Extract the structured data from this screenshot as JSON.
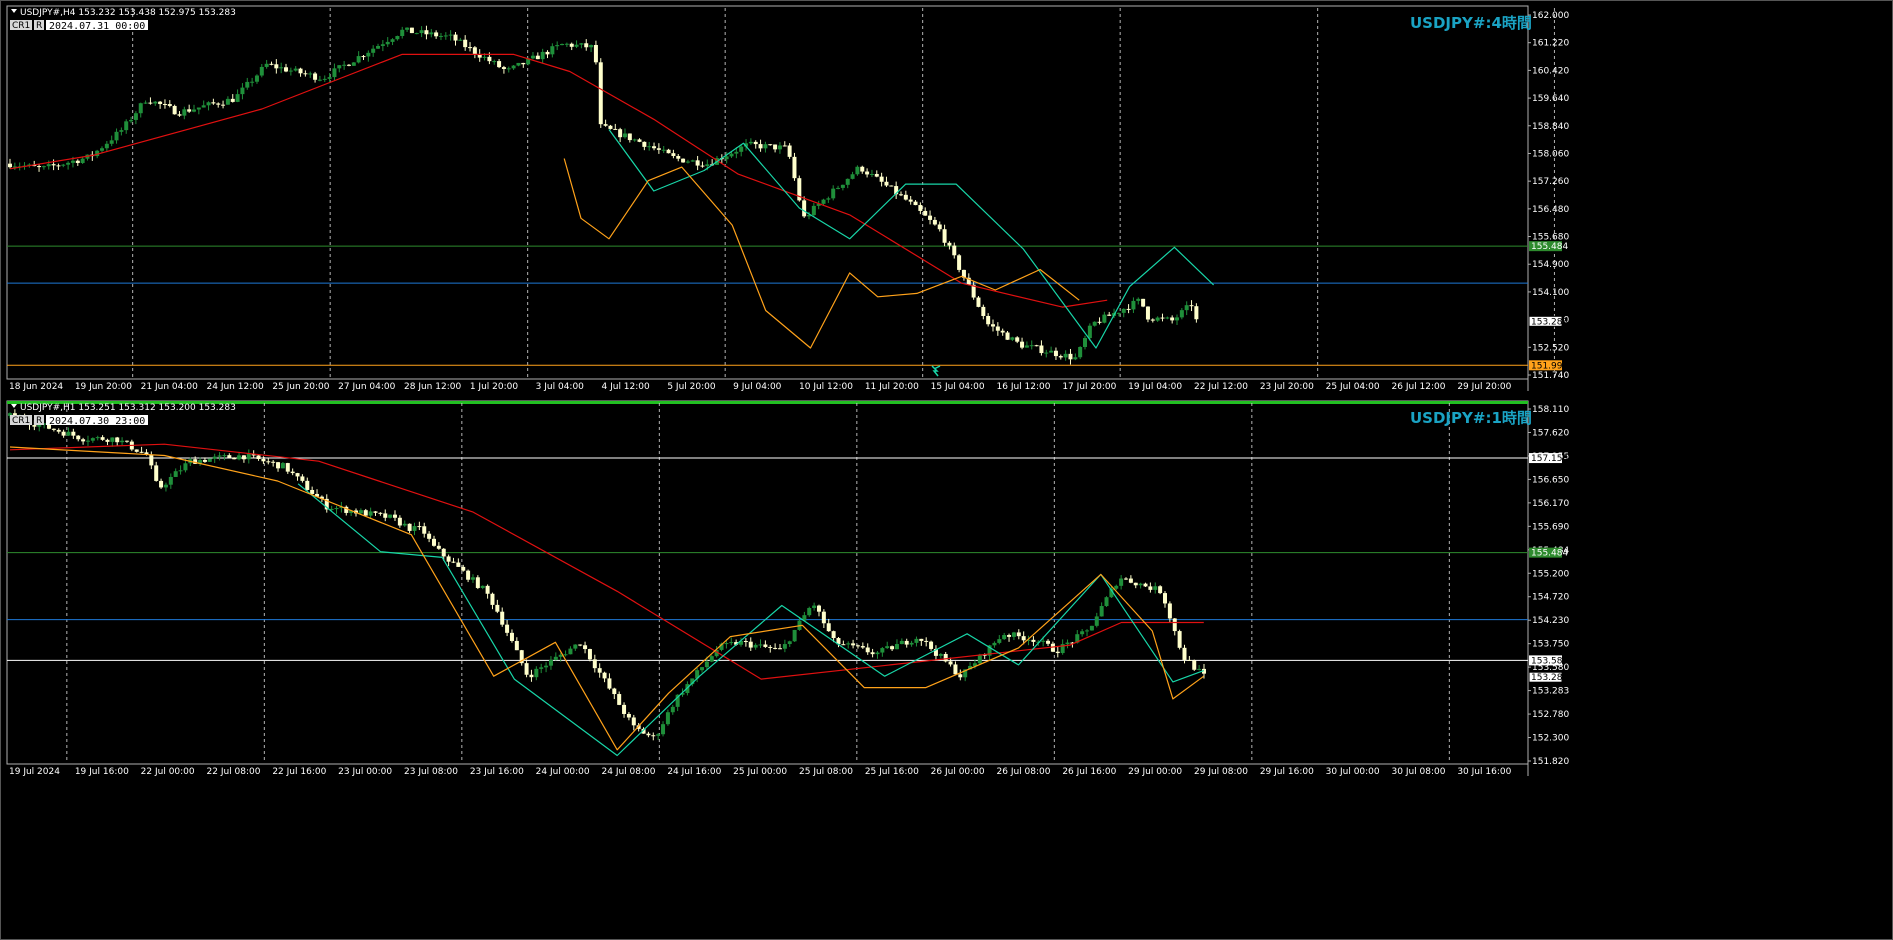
{
  "colors": {
    "background": "#000000",
    "foreground": "#ffffff",
    "grid": "#c8c8c8",
    "bull_candle": "#1f8f3a",
    "bear_candle": "#ffffcc",
    "ma_line": "#e01010",
    "fast_line": "#ffa21a",
    "slow_line": "#18d6a8",
    "hline_green": "#2e8b2e",
    "hline_blue": "#1e78d6",
    "hline_orange": "#ffa21a",
    "hline_white": "#ffffff",
    "watermark": "#1aa3c4"
  },
  "chart_data": [
    {
      "type": "candlestick",
      "panel": "top",
      "header": "USDJPY#,H4  153.232 153.438 152.975 153.283",
      "watermark": "USDJPY#:4時間",
      "crosshair": {
        "cr_label": "CR1",
        "r_label": "R",
        "datetime": "2024.07.31 00:00"
      },
      "ylim": [
        151.74,
        162.4
      ],
      "y_ticks": [
        "162.000",
        "161.220",
        "160.420",
        "159.640",
        "158.840",
        "158.060",
        "157.260",
        "156.480",
        "155.680",
        "154.900",
        "154.100",
        "153.520",
        "152.520",
        "151.740"
      ],
      "x_ticks": [
        "18 Jun 2024",
        "19 Jun 20:00",
        "21 Jun 04:00",
        "24 Jun 12:00",
        "25 Jun 20:00",
        "27 Jun 04:00",
        "28 Jun 12:00",
        "1 Jul 20:00",
        "3 Jul 04:00",
        "4 Jul 12:00",
        "5 Jul 20:00",
        "9 Jul 04:00",
        "10 Jul 12:00",
        "11 Jul 20:00",
        "15 Jul 04:00",
        "16 Jul 12:00",
        "17 Jul 20:00",
        "19 Jul 04:00",
        "22 Jul 12:00",
        "23 Jul 20:00",
        "25 Jul 04:00",
        "26 Jul 12:00",
        "29 Jul 20:00"
      ],
      "grid_after_tick": [
        2,
        5,
        8,
        11,
        14,
        17,
        20
      ],
      "grid_extra": [
        1.475
      ],
      "n_candles": 246,
      "anchors": [
        [
          0,
          157.9
        ],
        [
          8,
          157.75
        ],
        [
          20,
          158.1
        ],
        [
          28,
          158.9
        ],
        [
          34,
          159.8
        ],
        [
          42,
          159.4
        ],
        [
          56,
          159.8
        ],
        [
          64,
          160.8
        ],
        [
          78,
          160.4
        ],
        [
          98,
          161.8
        ],
        [
          110,
          161.6
        ],
        [
          124,
          160.6
        ],
        [
          138,
          161.4
        ],
        [
          146,
          161.3
        ],
        [
          147,
          159
        ],
        [
          158,
          158.5
        ],
        [
          166,
          158.05
        ],
        [
          174,
          157.9
        ],
        [
          184,
          158.45
        ],
        [
          194,
          158.35
        ],
        [
          198,
          156.3
        ],
        [
          212,
          157.8
        ],
        [
          224,
          156.8
        ],
        [
          232,
          155.95
        ],
        [
          244,
          153.2
        ],
        [
          252,
          152.6
        ],
        [
          266,
          152.2
        ],
        [
          270,
          153.2
        ],
        [
          282,
          153.9
        ],
        [
          284,
          153.4
        ],
        [
          290,
          153.3
        ],
        [
          295,
          153.8
        ],
        [
          296,
          153.3
        ]
      ],
      "ma": [
        [
          0,
          157.75
        ],
        [
          30,
          158.15
        ],
        [
          90,
          159.5
        ],
        [
          140,
          161.1
        ],
        [
          180,
          161.1
        ],
        [
          200,
          160.6
        ],
        [
          230,
          159.2
        ],
        [
          260,
          157.6
        ],
        [
          300,
          156.4
        ],
        [
          340,
          154.4
        ],
        [
          376,
          153.7
        ],
        [
          392,
          153.9
        ]
      ],
      "fast": [
        [
          198,
          158.05
        ],
        [
          204,
          156.3
        ],
        [
          214,
          155.7
        ],
        [
          228,
          157.4
        ],
        [
          240,
          157.8
        ],
        [
          258,
          156.1
        ],
        [
          270,
          153.6
        ],
        [
          286,
          152.5
        ],
        [
          300,
          154.7
        ],
        [
          310,
          154
        ],
        [
          324,
          154.1
        ],
        [
          340,
          154.6
        ],
        [
          352,
          154.2
        ],
        [
          368,
          154.8
        ],
        [
          382,
          153.9
        ]
      ],
      "slow": [
        [
          214,
          158.9
        ],
        [
          230,
          157.1
        ],
        [
          248,
          157.7
        ],
        [
          262,
          158.5
        ],
        [
          282,
          156.6
        ],
        [
          300,
          155.7
        ],
        [
          320,
          157.3
        ],
        [
          338,
          157.3
        ],
        [
          362,
          155.4
        ],
        [
          388,
          152.5
        ],
        [
          400,
          154.3
        ],
        [
          416,
          155.45
        ],
        [
          430,
          154.35
        ]
      ],
      "hlines": [
        {
          "price": 155.484,
          "color": "hline_green",
          "label": "155.484"
        },
        {
          "price": 154.4,
          "color": "hline_blue",
          "label": ""
        },
        {
          "price": 151.995,
          "color": "hline_orange",
          "label": "151.995"
        }
      ],
      "price_tag": "153.283",
      "marker_at": 0.62
    },
    {
      "type": "candlestick",
      "panel": "bottom",
      "header": "USDJPY#,H1  153.251 153.312 153.200 153.283",
      "watermark": "USDJPY#:1時間",
      "crosshair": {
        "cr_label": "CR1",
        "r_label": "R",
        "datetime": "2024.07.30 23:00"
      },
      "ylim": [
        151.82,
        158.11
      ],
      "y_ticks": [
        "158.110",
        "157.620",
        "157.155",
        "156.650",
        "156.170",
        "155.690",
        "155.484",
        "155.200",
        "154.720",
        "154.230",
        "153.750",
        "153.580",
        "153.283",
        "152.780",
        "152.300",
        "151.820"
      ],
      "x_ticks": [
        "19 Jul 2024",
        "19 Jul 16:00",
        "22 Jul 00:00",
        "22 Jul 08:00",
        "22 Jul 16:00",
        "23 Jul 00:00",
        "23 Jul 08:00",
        "23 Jul 16:00",
        "24 Jul 00:00",
        "24 Jul 08:00",
        "24 Jul 16:00",
        "25 Jul 00:00",
        "25 Jul 08:00",
        "25 Jul 16:00",
        "26 Jul 00:00",
        "26 Jul 08:00",
        "26 Jul 16:00",
        "29 Jul 00:00",
        "29 Jul 08:00",
        "29 Jul 16:00",
        "30 Jul 00:00",
        "30 Jul 08:00",
        "30 Jul 16:00"
      ],
      "grid_after_tick": [
        1,
        4,
        7,
        10,
        13,
        16,
        19,
        22
      ],
      "grid_extra": [],
      "n_candles": 246,
      "anchors": [
        [
          0,
          157.9
        ],
        [
          14,
          157.5
        ],
        [
          20,
          157.5
        ],
        [
          26,
          157.2
        ],
        [
          28,
          156.6
        ],
        [
          34,
          157.1
        ],
        [
          44,
          157.2
        ],
        [
          52,
          157
        ],
        [
          60,
          156.3
        ],
        [
          72,
          156.1
        ],
        [
          76,
          155.9
        ],
        [
          78,
          155.9
        ],
        [
          80,
          155.6
        ],
        [
          90,
          154.8
        ],
        [
          92,
          154.5
        ],
        [
          98,
          153.3
        ],
        [
          108,
          153.9
        ],
        [
          118,
          152.4
        ],
        [
          122,
          152.2
        ],
        [
          126,
          152.9
        ],
        [
          134,
          153.8
        ],
        [
          138,
          153.9
        ],
        [
          146,
          153.75
        ],
        [
          152,
          154.6
        ],
        [
          156,
          153.9
        ],
        [
          164,
          153.7
        ],
        [
          172,
          154
        ],
        [
          180,
          153.3
        ],
        [
          188,
          154.05
        ],
        [
          194,
          153.95
        ],
        [
          198,
          153.75
        ],
        [
          204,
          154.1
        ],
        [
          210,
          155.05
        ],
        [
          218,
          154.8
        ],
        [
          222,
          153.65
        ],
        [
          226,
          153.3
        ]
      ],
      "ma": [
        [
          0,
          157.3
        ],
        [
          30,
          157.4
        ],
        [
          60,
          157.1
        ],
        [
          90,
          156.2
        ],
        [
          118,
          154.8
        ],
        [
          146,
          153.25
        ],
        [
          176,
          153.55
        ],
        [
          206,
          153.85
        ],
        [
          216,
          154.25
        ],
        [
          232,
          154.25
        ]
      ],
      "fast": [
        [
          0,
          157.35
        ],
        [
          30,
          157.2
        ],
        [
          52,
          156.75
        ],
        [
          78,
          155.8
        ],
        [
          94,
          153.3
        ],
        [
          106,
          153.9
        ],
        [
          118,
          152.0
        ],
        [
          128,
          153.0
        ],
        [
          140,
          154.0
        ],
        [
          154,
          154.2
        ],
        [
          166,
          153.1
        ],
        [
          178,
          153.1
        ],
        [
          196,
          153.8
        ],
        [
          212,
          155.1
        ],
        [
          222,
          154.1
        ],
        [
          226,
          152.9
        ],
        [
          232,
          153.3
        ]
      ],
      "slow": [
        [
          56,
          156.7
        ],
        [
          72,
          155.5
        ],
        [
          84,
          155.4
        ],
        [
          98,
          153.25
        ],
        [
          118,
          151.9
        ],
        [
          134,
          153.3
        ],
        [
          150,
          154.55
        ],
        [
          170,
          153.3
        ],
        [
          186,
          154.05
        ],
        [
          196,
          153.5
        ],
        [
          212,
          155.1
        ],
        [
          226,
          153.2
        ],
        [
          232,
          153.4
        ]
      ],
      "hlines": [
        {
          "price": 157.155,
          "color": "hline_white",
          "label": "157.155"
        },
        {
          "price": 155.484,
          "color": "hline_green",
          "label": "155.484"
        },
        {
          "price": 154.3,
          "color": "hline_blue",
          "label": ""
        },
        {
          "price": 153.58,
          "color": "hline_white",
          "label": "153.580"
        }
      ],
      "price_tag": "153.283"
    }
  ]
}
